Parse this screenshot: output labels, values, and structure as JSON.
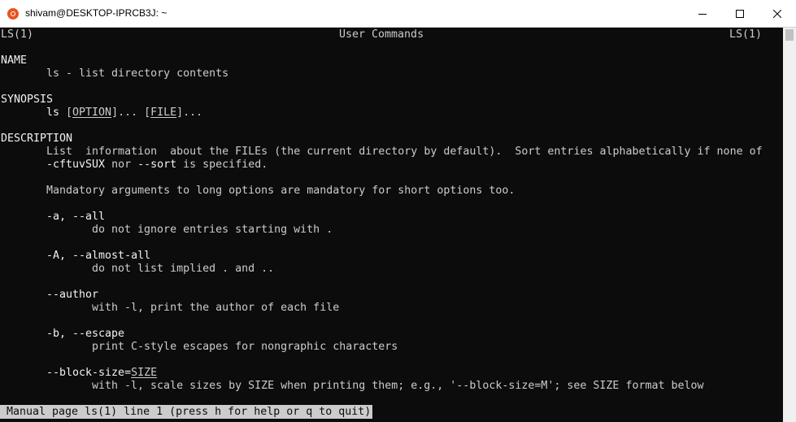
{
  "window": {
    "title": "shivam@DESKTOP-IPRCB3J: ~",
    "app_icon": "ubuntu-icon",
    "controls": [
      "minimize-icon",
      "maximize-icon",
      "close-icon"
    ]
  },
  "terminal": {
    "header": {
      "left": "LS(1)",
      "center": "User Commands",
      "right": "LS(1)"
    },
    "sections": {
      "name_heading": "NAME",
      "name_text": "ls - list directory contents",
      "synopsis_heading": "SYNOPSIS",
      "synopsis_cmd": "ls",
      "synopsis_option": "OPTION",
      "synopsis_file": "FILE",
      "description_heading": "DESCRIPTION",
      "desc_line1": "List  information  about the FILEs (the current directory by default).  Sort entries alphabetically if none of",
      "desc_line2_a": "-cftuvSUX",
      "desc_line2_b": " nor ",
      "desc_line2_c": "--sort",
      "desc_line2_d": " is specified.",
      "desc_line3": "Mandatory arguments to long options are mandatory for short options too.",
      "opt_all": "-a, --all",
      "opt_all_desc": "do not ignore entries starting with .",
      "opt_almost_all": "-A, --almost-all",
      "opt_almost_all_desc": "do not list implied . and ..",
      "opt_author": "--author",
      "opt_author_desc": "with -l, print the author of each file",
      "opt_escape": "-b, --escape",
      "opt_escape_desc": "print C-style escapes for nongraphic characters",
      "opt_block_size": "--block-size=",
      "opt_block_size_arg": "SIZE",
      "opt_block_size_desc": "with -l, scale sizes by SIZE when printing them; e.g., '--block-size=M'; see SIZE format below"
    },
    "status": "Manual page ls(1) line 1 (press h for help or q to quit)"
  }
}
